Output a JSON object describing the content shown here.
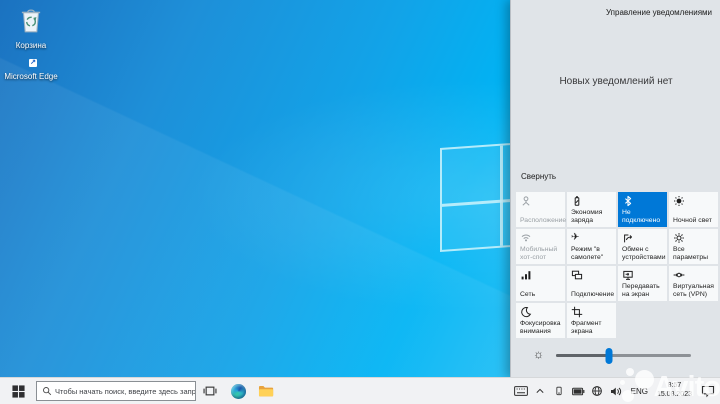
{
  "colors": {
    "accent": "#0078d7",
    "panel_bg": "#e0e4e8",
    "tile_bg": "#f7f9fa",
    "taskbar_bg": "#f1f2f4",
    "wallpaper_main": "#12a3e8"
  },
  "desktop": {
    "icons": [
      {
        "label": "Корзина",
        "icon": "recycle-bin-icon"
      },
      {
        "label": "Microsoft Edge",
        "icon": "edge-icon"
      }
    ]
  },
  "action_center": {
    "manage_link": "Управление уведомлениями",
    "empty_message": "Новых уведомлений нет",
    "collapse_label": "Свернуть",
    "tiles": [
      {
        "label": "Расположение",
        "icon": "location-icon",
        "state": "disabled"
      },
      {
        "label": "Экономия заряда",
        "icon": "battery-saver-icon",
        "state": "off"
      },
      {
        "label": "Не подключено",
        "icon": "bluetooth-icon",
        "state": "on"
      },
      {
        "label": "Ночной свет",
        "icon": "night-light-icon",
        "state": "off"
      },
      {
        "label": "Мобильный хот-спот",
        "icon": "mobile-hotspot-icon",
        "state": "disabled"
      },
      {
        "label": "Режим \"в самолете\"",
        "icon": "airplane-mode-icon",
        "state": "off"
      },
      {
        "label": "Обмен с устройствами",
        "icon": "nearby-sharing-icon",
        "state": "off"
      },
      {
        "label": "Все параметры",
        "icon": "settings-gear-icon",
        "state": "off"
      },
      {
        "label": "Сеть",
        "icon": "network-icon",
        "state": "off"
      },
      {
        "label": "Подключение",
        "icon": "connect-icon",
        "state": "off"
      },
      {
        "label": "Передавать на экран",
        "icon": "project-icon",
        "state": "off"
      },
      {
        "label": "Виртуальная сеть (VPN)",
        "icon": "vpn-icon",
        "state": "off"
      },
      {
        "label": "Фокусировка внимания",
        "icon": "focus-assist-icon",
        "state": "off"
      },
      {
        "label": "Фрагмент экрана",
        "icon": "screen-snip-icon",
        "state": "off"
      }
    ],
    "brightness_percent": 39
  },
  "taskbar": {
    "search_placeholder": "Чтобы начать поиск, введите здесь запрос",
    "tray": {
      "language": "ENG",
      "time": "8:57",
      "date": "15.08.2023"
    }
  },
  "watermark": {
    "text": "Avito"
  }
}
